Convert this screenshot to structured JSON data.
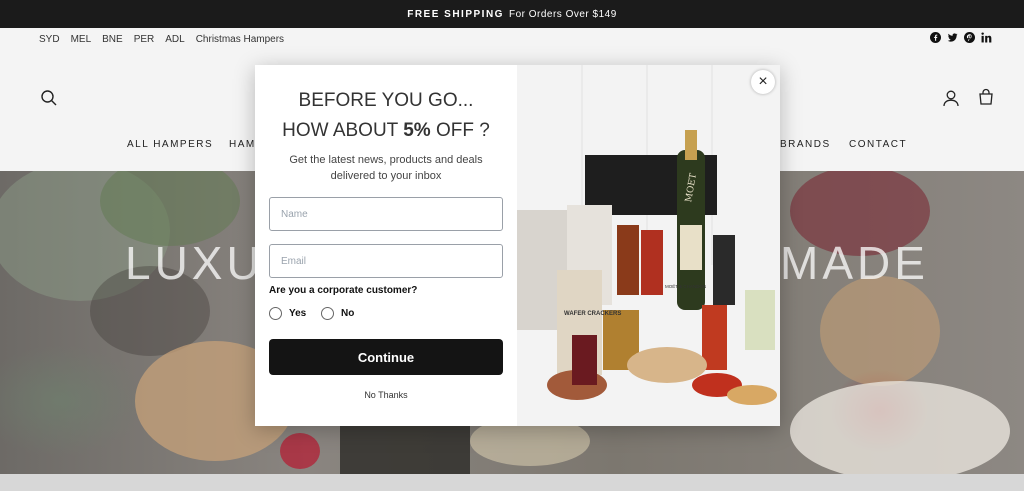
{
  "announcement": {
    "bold": "FREE SHIPPING",
    "text": "For Orders Over $149"
  },
  "utility_links": [
    "SYD",
    "MEL",
    "BNE",
    "PER",
    "ADL",
    "Christmas Hampers"
  ],
  "social": [
    "facebook-icon",
    "twitter-icon",
    "pinterest-icon",
    "linkedin-icon"
  ],
  "nav": {
    "all_hampers": "ALL HAMPERS",
    "ham": "HAM",
    "brands": "BRANDS",
    "contact": "CONTACT"
  },
  "hero": {
    "left": "LUXU",
    "right": "MADE"
  },
  "popup": {
    "title_line1": "BEFORE YOU GO...",
    "title_line2_pre": "HOW ABOUT ",
    "title_line2_bold": "5%",
    "title_line2_post": " OFF ?",
    "subtitle": "Get the latest news, products and deals delivered to your inbox",
    "name_placeholder": "Name",
    "email_placeholder": "Email",
    "question": "Are you a corporate customer?",
    "yes": "Yes",
    "no": "No",
    "continue": "Continue",
    "no_thanks": "No Thanks",
    "close": "×"
  },
  "product_image_text": {
    "moet": "MOET",
    "wafer": "WAFER CRACKERS",
    "brand": "MOËT & CHANDON"
  }
}
